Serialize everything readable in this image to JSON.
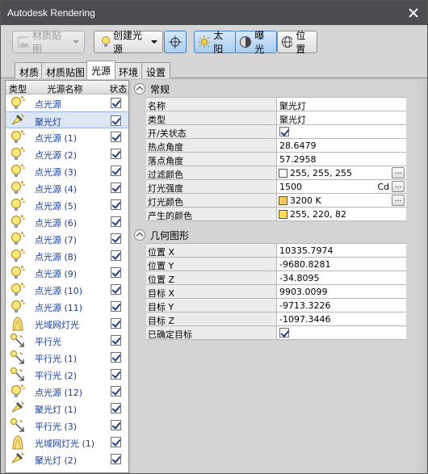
{
  "window": {
    "title": "Autodesk Rendering"
  },
  "toolbar": {
    "material_map": "材质贴图",
    "create_light": "创建光源",
    "sun": "太阳",
    "exposure": "曝光",
    "location": "位置"
  },
  "tabs": [
    "材质",
    "材质贴图",
    "光源",
    "环境",
    "设置"
  ],
  "active_tab": "光源",
  "light_list": {
    "headers": {
      "type": "类型",
      "name": "光源名称",
      "status": "状态"
    },
    "items": [
      {
        "name": "点光源",
        "icon": "point-light-icon",
        "on": true
      },
      {
        "name": "聚光灯",
        "icon": "spot-light-icon",
        "on": true,
        "selected": true
      },
      {
        "name": "点光源 (1)",
        "icon": "point-light-icon",
        "on": true
      },
      {
        "name": "点光源 (2)",
        "icon": "point-light-icon",
        "on": true
      },
      {
        "name": "点光源 (3)",
        "icon": "point-light-icon",
        "on": true
      },
      {
        "name": "点光源 (4)",
        "icon": "point-light-icon",
        "on": true
      },
      {
        "name": "点光源 (5)",
        "icon": "point-light-icon",
        "on": true
      },
      {
        "name": "点光源 (6)",
        "icon": "point-light-icon",
        "on": true
      },
      {
        "name": "点光源 (7)",
        "icon": "point-light-icon",
        "on": true
      },
      {
        "name": "点光源 (8)",
        "icon": "point-light-icon",
        "on": true
      },
      {
        "name": "点光源 (9)",
        "icon": "point-light-icon",
        "on": true
      },
      {
        "name": "点光源 (10)",
        "icon": "point-light-icon",
        "on": true
      },
      {
        "name": "点光源 (11)",
        "icon": "point-light-icon",
        "on": true
      },
      {
        "name": "光域网灯光",
        "icon": "web-light-icon",
        "on": true
      },
      {
        "name": "平行光",
        "icon": "distant-light-icon",
        "on": true
      },
      {
        "name": "平行光 (1)",
        "icon": "distant-light-icon",
        "on": true
      },
      {
        "name": "平行光 (2)",
        "icon": "distant-light-icon",
        "on": true
      },
      {
        "name": "点光源 (12)",
        "icon": "point-light-icon",
        "on": true
      },
      {
        "name": "聚光灯 (1)",
        "icon": "spot-light-icon",
        "on": true
      },
      {
        "name": "平行光 (3)",
        "icon": "distant-light-icon",
        "on": true
      },
      {
        "name": "光域网灯光 (1)",
        "icon": "web-light-icon",
        "on": true
      },
      {
        "name": "聚光灯 (2)",
        "icon": "spot-light-icon",
        "on": true
      }
    ]
  },
  "general": {
    "title": "常规",
    "rows": [
      {
        "label": "名称",
        "value": "聚光灯"
      },
      {
        "label": "类型",
        "value": "聚光灯"
      },
      {
        "label": "开/关状态",
        "checkbox": true
      },
      {
        "label": "热点角度",
        "value": "28.6479"
      },
      {
        "label": "落点角度",
        "value": "57.2958"
      },
      {
        "label": "过滤颜色",
        "value": "255, 255, 255",
        "swatch": "#ffffff",
        "button": "..."
      },
      {
        "label": "灯光强度",
        "value": "1500",
        "unit": "Cd",
        "button": "..."
      },
      {
        "label": "灯光颜色",
        "value": "3200 K",
        "swatch": "#f5c85b",
        "button": "..."
      },
      {
        "label": "产生的颜色",
        "value": "255, 220, 82",
        "swatch": "#ffdc52"
      }
    ]
  },
  "geometry": {
    "title": "几何图形",
    "rows": [
      {
        "label": "位置 X",
        "value": "10335.7974"
      },
      {
        "label": "位置 Y",
        "value": "-9680.8281"
      },
      {
        "label": "位置 Z",
        "value": "-34.8095"
      },
      {
        "label": "目标 X",
        "value": "9903.0099"
      },
      {
        "label": "目标 Y",
        "value": "-9713.3226"
      },
      {
        "label": "目标 Z",
        "value": "-1097.3446"
      },
      {
        "label": "已确定目标",
        "checkbox": true
      }
    ]
  },
  "colors": {
    "accent": "#1a3e9e",
    "selected_row": "#dde7f3",
    "titlebar": "#4b4d51"
  }
}
